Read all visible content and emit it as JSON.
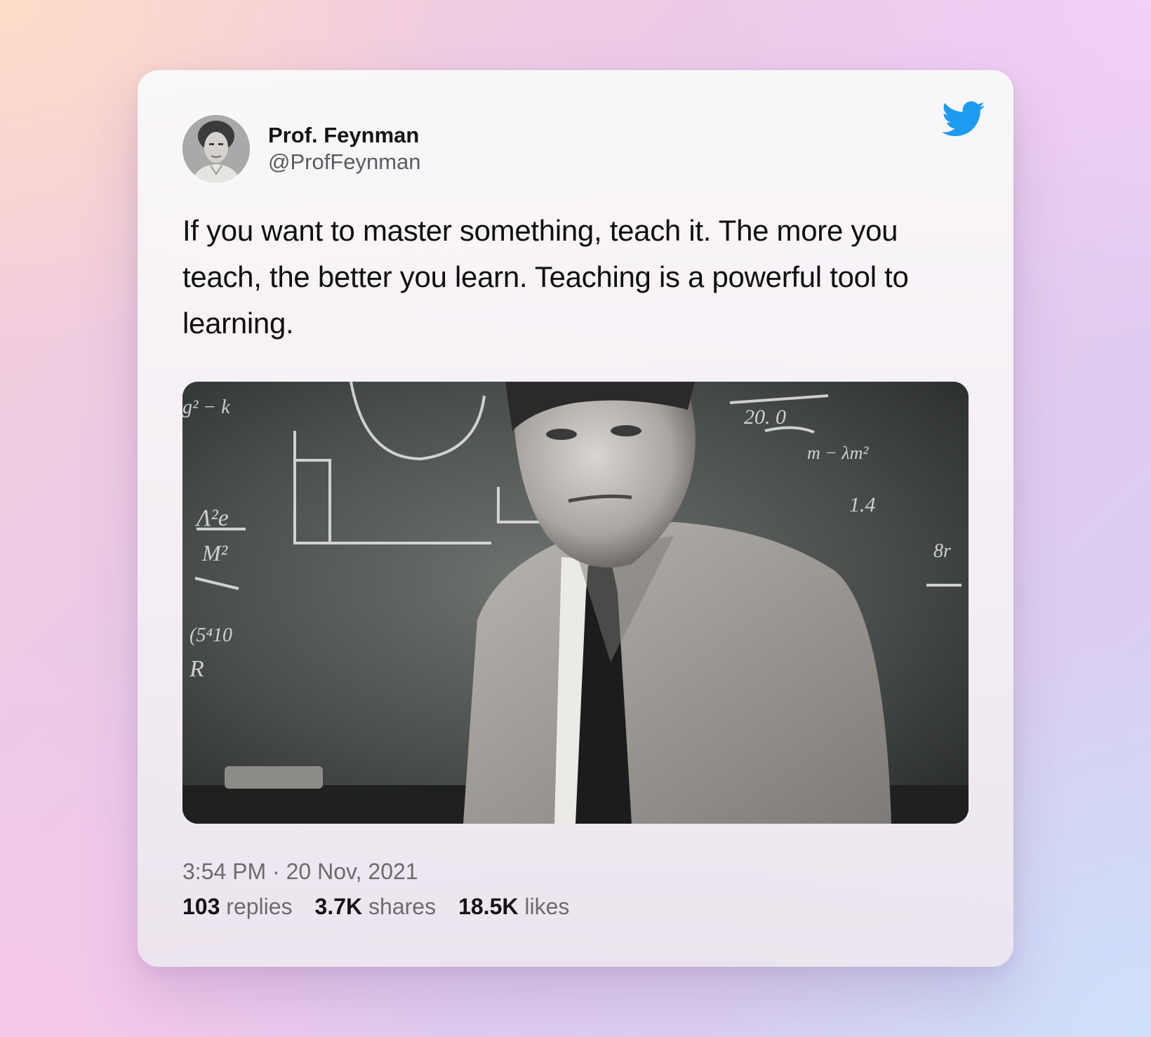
{
  "tweet": {
    "author": {
      "name": "Prof. Feynman",
      "handle": "@ProfFeynman"
    },
    "text": "If you want to master something, teach it. The more you teach, the better you learn. Teaching is a powerful tool to learning.",
    "timestamp": "3:54 PM · 20 Nov, 2021",
    "stats": {
      "replies": {
        "count": "103",
        "label": "replies"
      },
      "shares": {
        "count": "3.7K",
        "label": "shares"
      },
      "likes": {
        "count": "18.5K",
        "label": "likes"
      }
    }
  },
  "icons": {
    "brand": "twitter-bird-icon"
  },
  "colors": {
    "twitter_blue": "#1d9bf0",
    "text_primary": "#141414",
    "text_secondary": "#6b6b70"
  }
}
